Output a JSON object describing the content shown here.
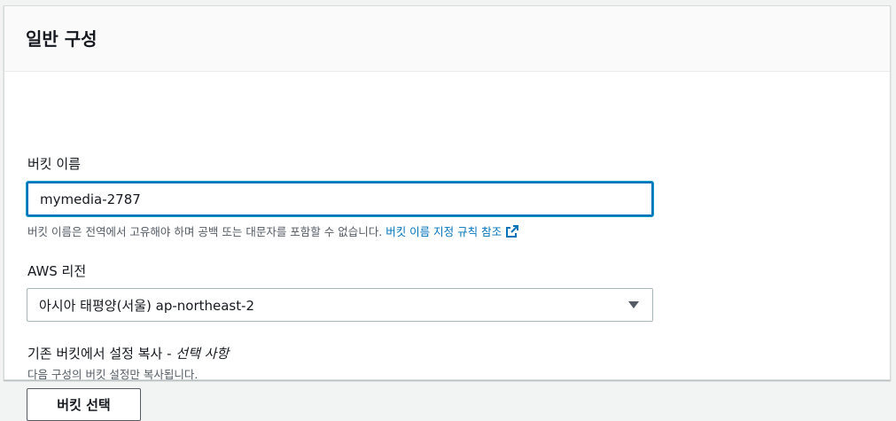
{
  "panel": {
    "title": "일반 구성"
  },
  "bucket_name": {
    "label": "버킷 이름",
    "value": "mymedia-2787",
    "hint": "버킷 이름은 전역에서 고유해야 하며 공백 또는 대문자를 포함할 수 없습니다.",
    "link_text": "버킷 이름 지정 규칙 참조",
    "link_icon": "external-link-icon"
  },
  "region": {
    "label": "AWS 리전",
    "selected": "아시아 태평양(서울) ap-northeast-2",
    "caret_icon": "caret-down-icon"
  },
  "copy_settings": {
    "label": "기존 버킷에서 설정 복사 - ",
    "optional": "선택 사항",
    "hint": "다음 구성의 버킷 설정만 복사됩니다.",
    "button_label": "버킷 선택"
  },
  "colors": {
    "accent": "#0073bb",
    "text": "#16191f",
    "muted": "#545b64"
  }
}
